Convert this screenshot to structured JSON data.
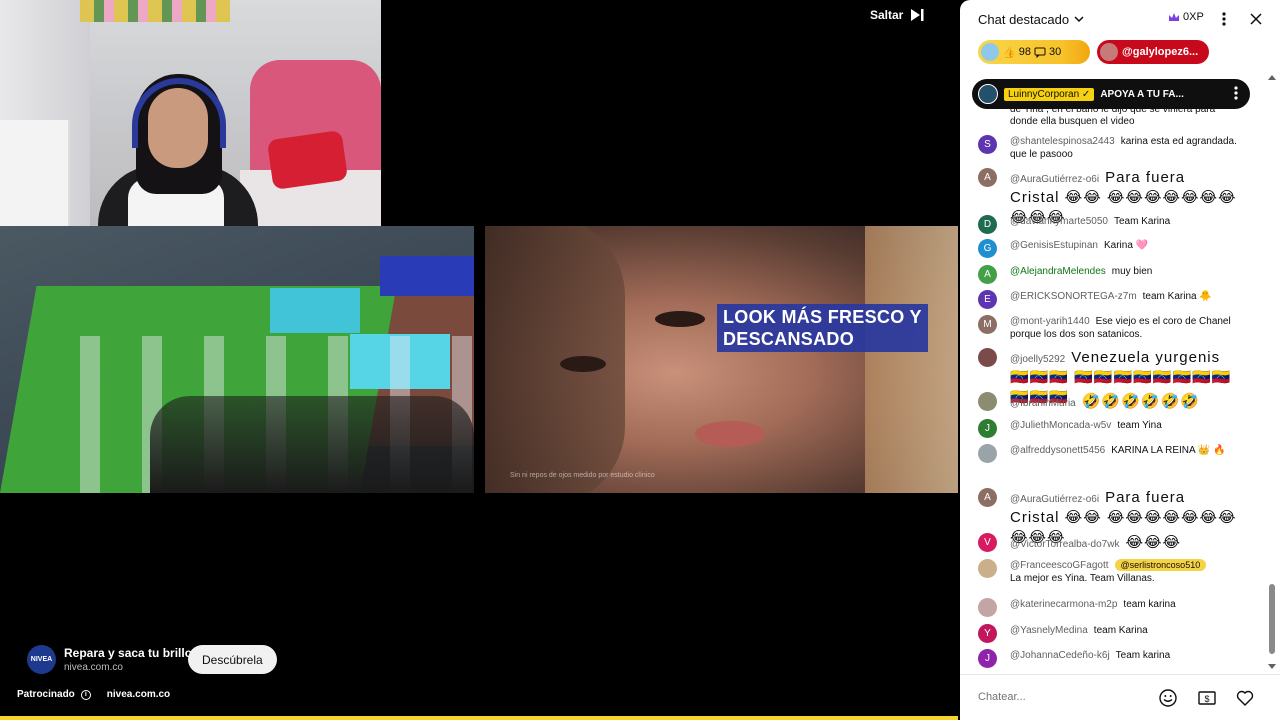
{
  "player": {
    "skip_label": "Saltar",
    "ad_caption_line1": "LOOK MÁS FRESCO Y",
    "ad_caption_line2": "DESCANSADO",
    "ad_disclaimer": "Sin ni repos de ojos medido por estudio clínico",
    "ad_title": "Repara y saca tu brillo",
    "ad_domain": "nivea.com.co",
    "ad_logo": "NIVEA",
    "cta_label": "Descúbrela",
    "sponsored_label": "Patrocinado",
    "sponsored_domain": "nivea.com.co",
    "progress_fraction": 1.0,
    "progress_color": "#f7d32c"
  },
  "chat": {
    "title": "Chat destacado",
    "xp": "0XP",
    "tickers": [
      {
        "likes": "98",
        "comments": "30"
      },
      {
        "name": "@galylopez6..."
      }
    ],
    "pinned": {
      "author": "LuinnyCorporan ✓",
      "text": "APOYA A TU FA..."
    },
    "partial_top": "de Yina , en el baño le dijo que se viniera para donde ella busquen el video",
    "messages": [
      {
        "initial": "S",
        "color": "#5e35b1",
        "author": "@shantelespinosa2443",
        "text": "karina esta ed agrandada. que le pasooo"
      },
      {
        "initial": "A",
        "color": "#8d6e63",
        "author": "@AuraGutiérrez-o6i",
        "text": "Para fuera Cristal 😂😂 😂😂😂😂😂😂😂😂😂😂"
      },
      {
        "initial": "D",
        "color": "#1e6b4f",
        "author": "@daviannymarte5050",
        "text": "Team Karina"
      },
      {
        "initial": "G",
        "color": "#1f8fcf",
        "author": "@GenisisEstupinan",
        "text": "Karina 🩷"
      },
      {
        "initial": "A",
        "color": "#43a047",
        "author": "@AlejandraMelendes",
        "text": "muy bien"
      },
      {
        "initial": "E",
        "color": "#5e35b1",
        "author": "@ERICKSONORTEGA-z7m",
        "text": "team Karina 🐥"
      },
      {
        "initial": "M",
        "color": "#8d6e63",
        "author": "@mont-yarih1440",
        "text": "Ese viejo es el coro de Chanel porque los dos son satanicos."
      },
      {
        "initial": "",
        "color": "#7b4b4b",
        "author": "@joelly5292",
        "text": "Venezuela yurgenis 🇻🇪🇻🇪🇻🇪 🇻🇪🇻🇪🇻🇪🇻🇪🇻🇪🇻🇪🇻🇪🇻🇪🇻🇪🇻🇪🇻🇪"
      },
      {
        "initial": "",
        "color": "#8c8c70",
        "author": "@IbrahinMuria",
        "text": "🤣🤣🤣🤣🤣🤣"
      },
      {
        "initial": "J",
        "color": "#2e7d32",
        "author": "@JuliethMoncada-w5v",
        "text": "team Yina"
      },
      {
        "initial": "",
        "color": "#9aa3a8",
        "author": "@alfreddysonett5456",
        "text": "KARINA LA REINA 👑 🔥"
      },
      {
        "initial": "A",
        "color": "#8d6e63",
        "author": "@AuraGutiérrez-o6i",
        "text": "Para fuera Cristal 😂😂 😂😂😂😂😂😂😂😂😂😂"
      },
      {
        "initial": "V",
        "color": "#d81b60",
        "author": "@VictorTorrealba-do7wk",
        "text": "😂😂😂"
      },
      {
        "initial": "",
        "color": "#c9b08a",
        "author": "@FranceescoGFagott",
        "mention": "@serlistroncoso510",
        "text": "La mejor es Yina. Team Villanas."
      },
      {
        "initial": "",
        "color": "#c4a4a4",
        "author": "@katerinecarmona-m2p",
        "text": "team karina"
      },
      {
        "initial": "Y",
        "color": "#c2185b",
        "author": "@YasnelyMedina",
        "text": "team Karina"
      },
      {
        "initial": "J",
        "color": "#8e24aa",
        "author": "@JohannaCedeño-k6j",
        "text": "Team karina"
      }
    ],
    "input_placeholder": "Chatear..."
  }
}
